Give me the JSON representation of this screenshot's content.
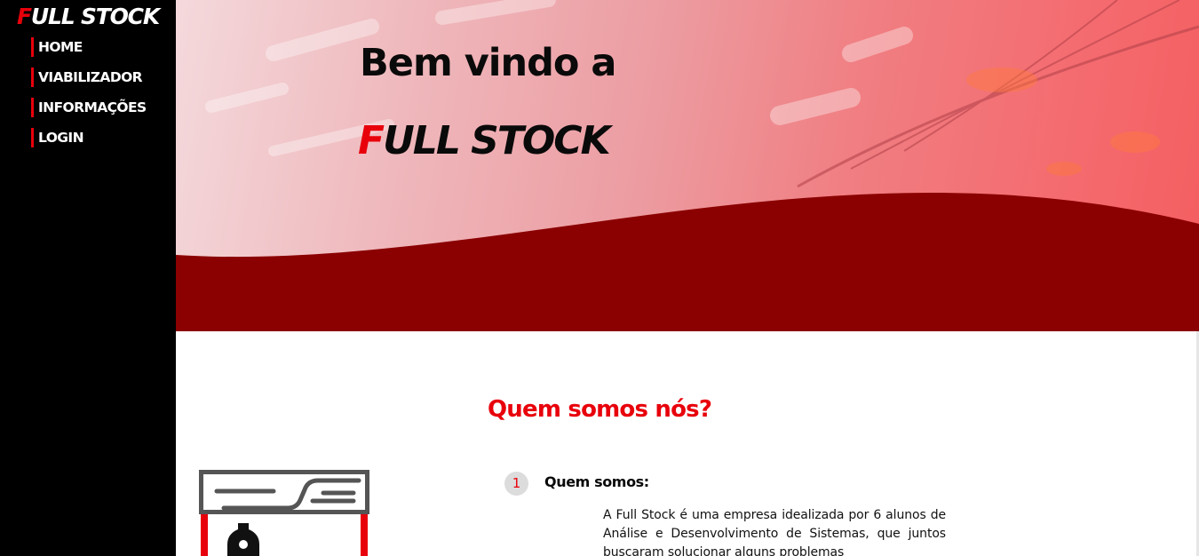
{
  "brand": {
    "logo_first": "F",
    "logo_rest": "ULL STOCK"
  },
  "nav": {
    "items": [
      {
        "label": "HOME"
      },
      {
        "label": "VIABILIZADOR"
      },
      {
        "label": "INFORMAÇÕES"
      },
      {
        "label": "LOGIN"
      }
    ]
  },
  "hero": {
    "title_line1": "Bem vindo a",
    "title_brand_first": "F",
    "title_brand_rest": "ULL STOCK"
  },
  "about": {
    "section_title": "Quem somos nós?",
    "step_number": "1",
    "step_title": "Quem somos:",
    "step_text": "A Full Stock é uma empresa idealizada por 6 alunos de Análise e Desenvolvimento de Sistemas, que juntos buscaram solucionar alguns problemas"
  },
  "colors": {
    "accent_red": "#e8000b",
    "wave_dark_red": "#8b0000",
    "sidebar_bg": "#000000"
  },
  "icons": {
    "illustration": "storefront-bottle-illustration"
  }
}
